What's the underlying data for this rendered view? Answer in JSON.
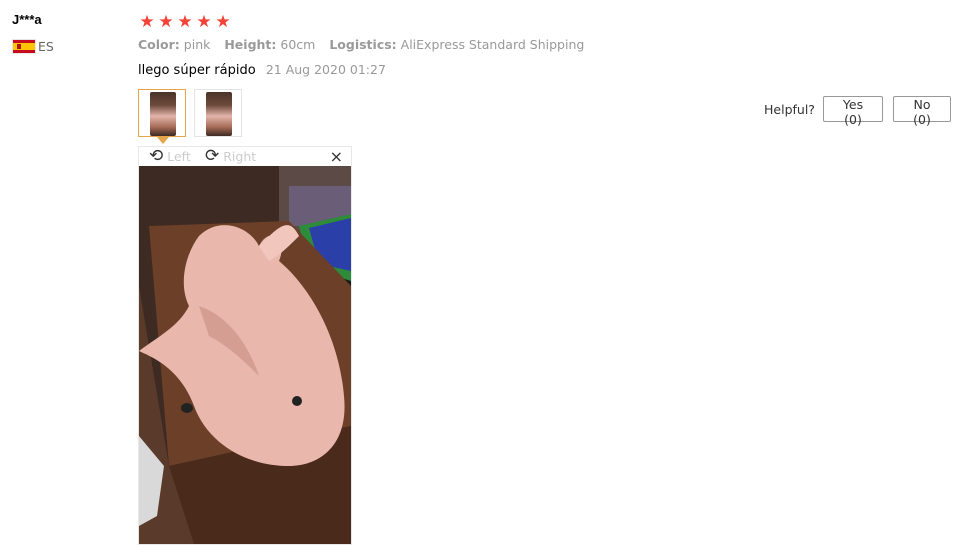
{
  "reviewer": {
    "name": "J***a",
    "country_code": "ES",
    "flag_icon": "spain-flag-icon"
  },
  "rating": {
    "stars": 5,
    "star_color": "#f44336"
  },
  "attributes": [
    {
      "key": "Color:",
      "value": "pink"
    },
    {
      "key": "Height:",
      "value": "60cm"
    },
    {
      "key": "Logistics:",
      "value": "AliExpress Standard Shipping"
    }
  ],
  "review": {
    "text": "llego súper rápido",
    "date": "21 Aug 2020 01:27"
  },
  "thumbnails": {
    "count": 2,
    "selected": 1
  },
  "viewer": {
    "rotate_left_label": "Left",
    "rotate_right_label": "Right",
    "close_symbol": "×"
  },
  "helpful": {
    "label": "Helpful?",
    "yes_label": "Yes (0)",
    "no_label": "No (0)"
  },
  "colors": {
    "accent_border": "#e5a54b"
  }
}
